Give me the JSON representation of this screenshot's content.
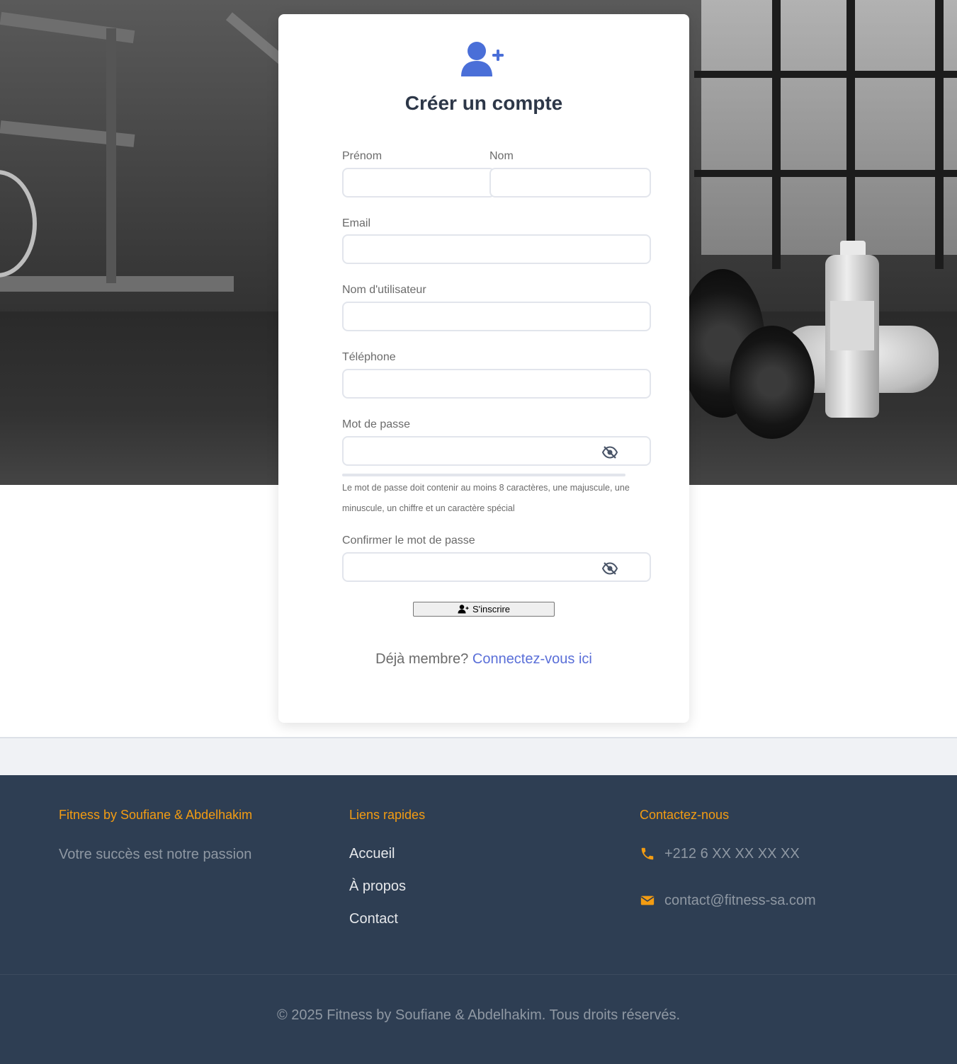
{
  "form": {
    "title": "Créer un compte",
    "firstname_label": "Prénom",
    "lastname_label": "Nom",
    "email_label": "Email",
    "username_label": "Nom d'utilisateur",
    "phone_label": "Téléphone",
    "password_label": "Mot de passe",
    "password_hint": "Le mot de passe doit contenir au moins 8 caractères, une majuscule, une minuscule, un chiffre et un caractère spécial",
    "confirm_label": "Confirmer le mot de passe",
    "submit_label": "S'inscrire",
    "already_member": "Déjà membre?",
    "login_link": "Connectez-vous ici",
    "icons": {
      "header": "user-plus-icon",
      "toggle": "eye-slash-icon",
      "submit": "user-plus-icon"
    }
  },
  "footer": {
    "brand_title": "Fitness by Soufiane & Abdelhakim",
    "tagline": "Votre succès est notre passion",
    "links_title": "Liens rapides",
    "links": [
      "Accueil",
      "À propos",
      "Contact"
    ],
    "contact_title": "Contactez-nous",
    "phone": "+212 6 XX XX XX XX",
    "email": "contact@fitness-sa.com",
    "copyright": "© 2025 Fitness by Soufiane & Abdelhakim. Tous droits réservés."
  },
  "colors": {
    "accent": "#4a6fd8",
    "footer_bg": "#2e3e53",
    "footer_heading": "#f39c12",
    "link": "#5a6fd8"
  }
}
